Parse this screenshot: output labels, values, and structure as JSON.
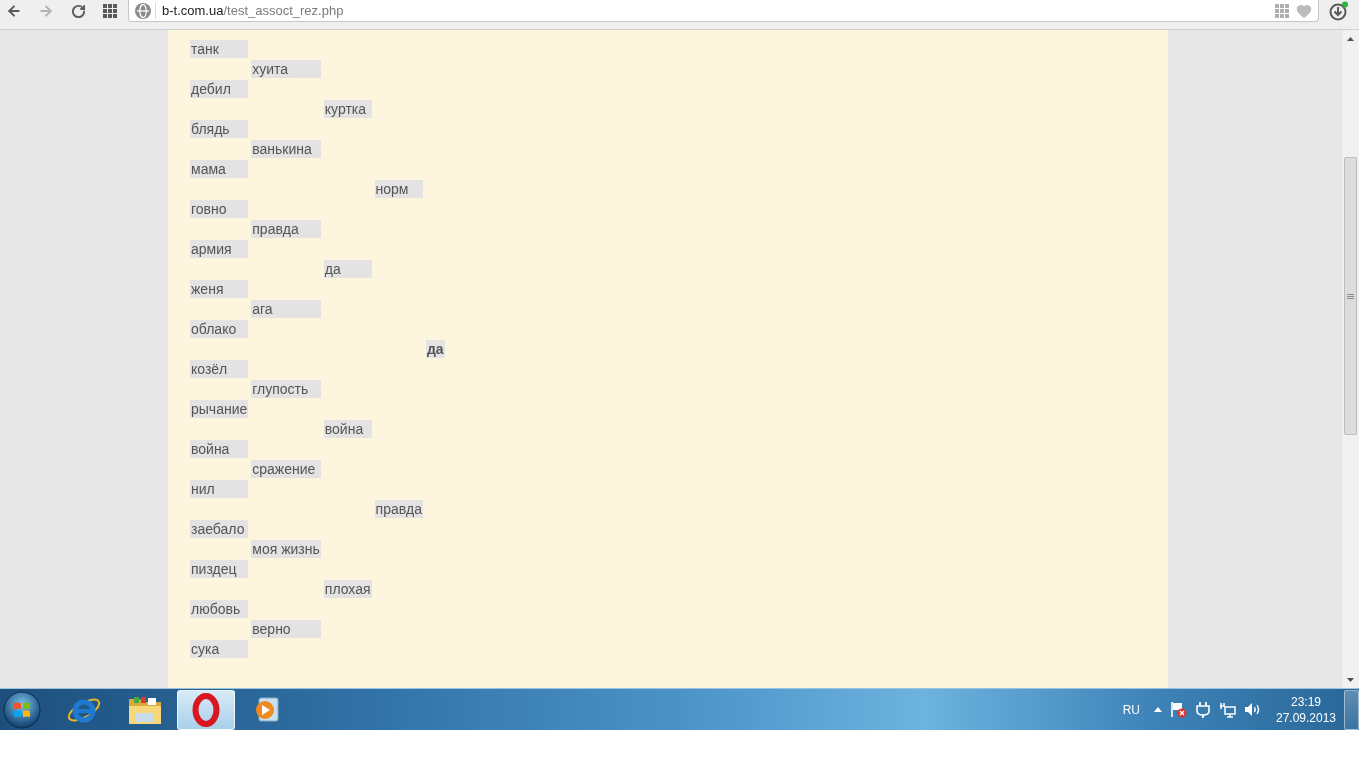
{
  "browser": {
    "nav_buttons": [
      {
        "kind": "back",
        "disabled": false
      },
      {
        "kind": "forward",
        "disabled": true
      },
      {
        "kind": "reload",
        "disabled": false
      },
      {
        "kind": "apps",
        "disabled": false
      }
    ],
    "address": {
      "host": "b-t.com.ua",
      "path": "/test_assoct_rez.php"
    }
  },
  "association_tree": {
    "label": "да",
    "children": [
      {
        "label": "норм",
        "children": [
          {
            "label": "куртка",
            "children": [
              {
                "label": "хуита",
                "children": [
                  {
                    "label": "танк"
                  },
                  {
                    "label": "дебил"
                  }
                ]
              },
              {
                "label": "ванькина",
                "children": [
                  {
                    "label": "блядь"
                  },
                  {
                    "label": "мама"
                  }
                ]
              }
            ]
          },
          {
            "label": "да",
            "children": [
              {
                "label": "правда",
                "children": [
                  {
                    "label": "говно"
                  },
                  {
                    "label": "армия"
                  }
                ]
              },
              {
                "label": "ага",
                "children": [
                  {
                    "label": "женя"
                  },
                  {
                    "label": "облако"
                  }
                ]
              }
            ]
          }
        ]
      },
      {
        "label": "правда",
        "children": [
          {
            "label": "война",
            "children": [
              {
                "label": "глупость",
                "children": [
                  {
                    "label": "козёл"
                  },
                  {
                    "label": "рычание"
                  }
                ]
              },
              {
                "label": "сражение",
                "children": [
                  {
                    "label": "война"
                  },
                  {
                    "label": "нил"
                  }
                ]
              }
            ]
          },
          {
            "label": "плохая",
            "children": [
              {
                "label": "моя жизнь",
                "children": [
                  {
                    "label": "заебало"
                  },
                  {
                    "label": "пиздец"
                  }
                ]
              },
              {
                "label": "верно",
                "children": [
                  {
                    "label": "любовь"
                  },
                  {
                    "label": "сука"
                  }
                ]
              }
            ]
          }
        ]
      }
    ]
  },
  "taskbar": {
    "apps": [
      {
        "kind": "e_globe",
        "selected": false
      },
      {
        "kind": "folder",
        "selected": false
      },
      {
        "kind": "o_ring",
        "selected": true
      },
      {
        "kind": "player",
        "selected": false
      }
    ],
    "language": "RU",
    "time": "23:19",
    "date": "27.09.2013"
  }
}
